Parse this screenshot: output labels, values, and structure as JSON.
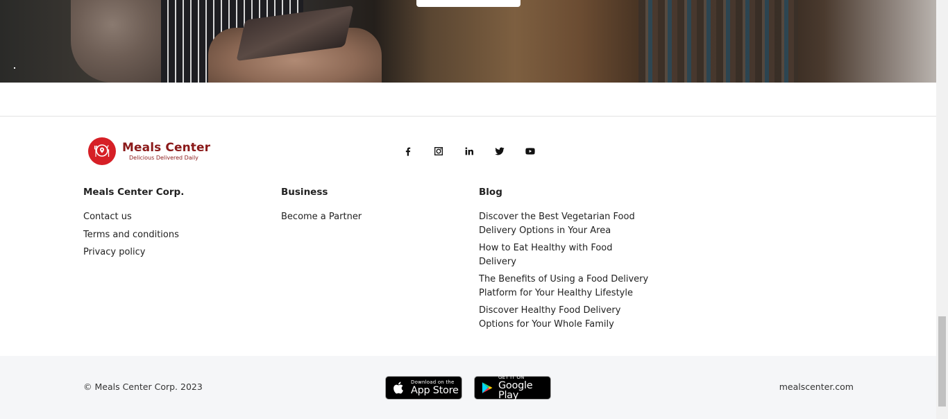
{
  "brand": {
    "name": "Meals Center",
    "tagline": "Delicious Delivered Daily",
    "color": "#d61f26"
  },
  "social": [
    {
      "name": "facebook-icon"
    },
    {
      "name": "instagram-icon"
    },
    {
      "name": "linkedin-icon"
    },
    {
      "name": "twitter-icon"
    },
    {
      "name": "youtube-icon"
    }
  ],
  "columns": {
    "company": {
      "heading": "Meals Center Corp.",
      "links": [
        "Contact us",
        "Terms and conditions",
        "Privacy policy"
      ]
    },
    "business": {
      "heading": "Business",
      "links": [
        "Become a Partner"
      ]
    },
    "blog": {
      "heading": "Blog",
      "links": [
        "Discover the Best Vegetarian Food Delivery Options in Your Area",
        "How to Eat Healthy with Food Delivery",
        "The Benefits of Using a Food Delivery Platform for Your Healthy Lifestyle",
        "Discover Healthy Food Delivery Options for Your Whole Family"
      ]
    }
  },
  "footer": {
    "copyright": "© Meals Center Corp. 2023",
    "domain": "mealscenter.com",
    "app_store": {
      "small": "Download on the",
      "big": "App Store"
    },
    "google_play": {
      "small": "GET IT ON",
      "big": "Google Play"
    }
  }
}
